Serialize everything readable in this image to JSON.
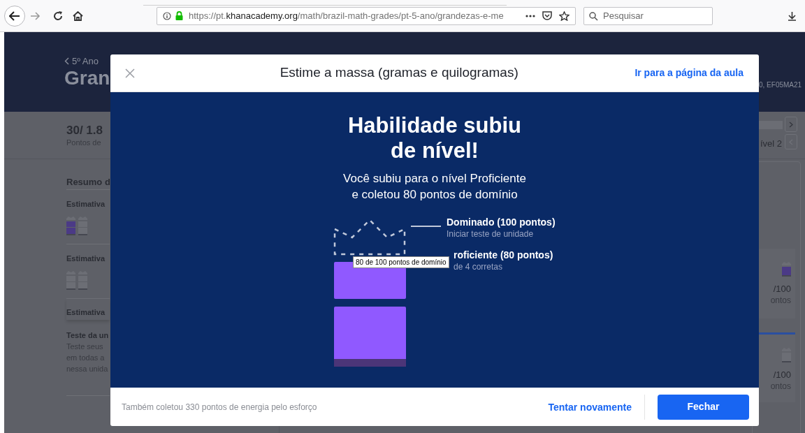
{
  "browser": {
    "url": {
      "prefix": "https://pt.",
      "domain": "khanacademy.org",
      "path": "/math/brazil-math-grades/pt-5-ano/grandezas-e-me"
    },
    "search": {
      "placeholder": "Pesquisar"
    }
  },
  "page": {
    "breadcrumb": "5º Ano",
    "title": "Gran",
    "points": "30/ 1.8",
    "points_label": "Pontos de",
    "section_title": "Resumo d",
    "skills": [
      {
        "title": "Estimativa",
        "blocks": [
          {
            "filled": true
          },
          {
            "filled": false
          }
        ]
      },
      {
        "title": "Estimativa",
        "blocks": [
          {
            "filled": false
          },
          {
            "filled": false
          }
        ]
      },
      {
        "title": "Estimativa"
      }
    ],
    "unit_test": {
      "title": "Teste da un",
      "lines": [
        "Teste seus",
        "em todas a",
        "nessa unida"
      ]
    },
    "right": {
      "standards": "0, EF05MA21",
      "level": "ível 2",
      "cards": [
        {
          "score": "/100",
          "unit": "ontos",
          "filled": true
        },
        {
          "score": "/100",
          "unit": "ontos",
          "filled": false
        }
      ]
    }
  },
  "modal": {
    "title": "Estime a massa (gramas e quilogramas)",
    "lesson_link": "Ir para a página da aula",
    "headline": [
      "Habilidade subiu",
      "de nível!"
    ],
    "message": [
      "Você subiu para o nível Proficiente",
      "e coletou 80 pontos de domínio"
    ],
    "blocks": [
      {
        "kind": "crown",
        "filled": false
      },
      {
        "kind": "block",
        "filled": true
      },
      {
        "kind": "block",
        "filled": true
      }
    ],
    "levels": [
      {
        "label": "Dominado (100 pontos)",
        "detail": "Iniciar teste de unidade"
      },
      {
        "label": "roficiente (80 pontos)",
        "detail": "de 4 corretas"
      }
    ],
    "tooltip": "80 de 100 pontos de domínio",
    "footer_note": "Também coletou 330 pontos de energia pelo esforço",
    "retry": "Tentar novamente",
    "close_button": "Fechar"
  }
}
